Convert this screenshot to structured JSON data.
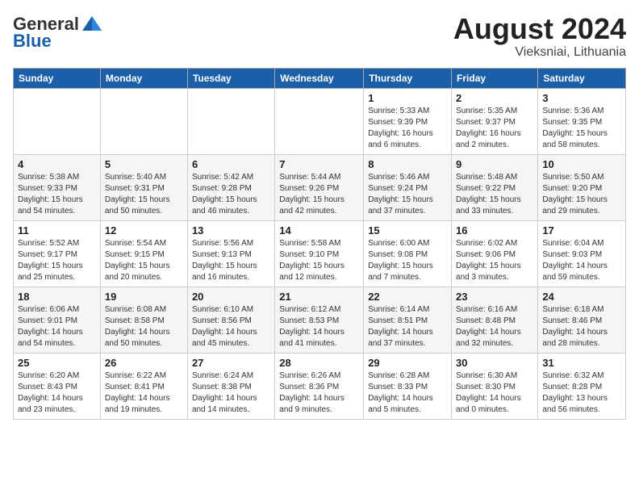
{
  "header": {
    "logo_general": "General",
    "logo_blue": "Blue",
    "month_title": "August 2024",
    "location": "Vieksniai, Lithuania"
  },
  "weekdays": [
    "Sunday",
    "Monday",
    "Tuesday",
    "Wednesday",
    "Thursday",
    "Friday",
    "Saturday"
  ],
  "weeks": [
    [
      {
        "day": "",
        "info": ""
      },
      {
        "day": "",
        "info": ""
      },
      {
        "day": "",
        "info": ""
      },
      {
        "day": "",
        "info": ""
      },
      {
        "day": "1",
        "info": "Sunrise: 5:33 AM\nSunset: 9:39 PM\nDaylight: 16 hours\nand 6 minutes."
      },
      {
        "day": "2",
        "info": "Sunrise: 5:35 AM\nSunset: 9:37 PM\nDaylight: 16 hours\nand 2 minutes."
      },
      {
        "day": "3",
        "info": "Sunrise: 5:36 AM\nSunset: 9:35 PM\nDaylight: 15 hours\nand 58 minutes."
      }
    ],
    [
      {
        "day": "4",
        "info": "Sunrise: 5:38 AM\nSunset: 9:33 PM\nDaylight: 15 hours\nand 54 minutes."
      },
      {
        "day": "5",
        "info": "Sunrise: 5:40 AM\nSunset: 9:31 PM\nDaylight: 15 hours\nand 50 minutes."
      },
      {
        "day": "6",
        "info": "Sunrise: 5:42 AM\nSunset: 9:28 PM\nDaylight: 15 hours\nand 46 minutes."
      },
      {
        "day": "7",
        "info": "Sunrise: 5:44 AM\nSunset: 9:26 PM\nDaylight: 15 hours\nand 42 minutes."
      },
      {
        "day": "8",
        "info": "Sunrise: 5:46 AM\nSunset: 9:24 PM\nDaylight: 15 hours\nand 37 minutes."
      },
      {
        "day": "9",
        "info": "Sunrise: 5:48 AM\nSunset: 9:22 PM\nDaylight: 15 hours\nand 33 minutes."
      },
      {
        "day": "10",
        "info": "Sunrise: 5:50 AM\nSunset: 9:20 PM\nDaylight: 15 hours\nand 29 minutes."
      }
    ],
    [
      {
        "day": "11",
        "info": "Sunrise: 5:52 AM\nSunset: 9:17 PM\nDaylight: 15 hours\nand 25 minutes."
      },
      {
        "day": "12",
        "info": "Sunrise: 5:54 AM\nSunset: 9:15 PM\nDaylight: 15 hours\nand 20 minutes."
      },
      {
        "day": "13",
        "info": "Sunrise: 5:56 AM\nSunset: 9:13 PM\nDaylight: 15 hours\nand 16 minutes."
      },
      {
        "day": "14",
        "info": "Sunrise: 5:58 AM\nSunset: 9:10 PM\nDaylight: 15 hours\nand 12 minutes."
      },
      {
        "day": "15",
        "info": "Sunrise: 6:00 AM\nSunset: 9:08 PM\nDaylight: 15 hours\nand 7 minutes."
      },
      {
        "day": "16",
        "info": "Sunrise: 6:02 AM\nSunset: 9:06 PM\nDaylight: 15 hours\nand 3 minutes."
      },
      {
        "day": "17",
        "info": "Sunrise: 6:04 AM\nSunset: 9:03 PM\nDaylight: 14 hours\nand 59 minutes."
      }
    ],
    [
      {
        "day": "18",
        "info": "Sunrise: 6:06 AM\nSunset: 9:01 PM\nDaylight: 14 hours\nand 54 minutes."
      },
      {
        "day": "19",
        "info": "Sunrise: 6:08 AM\nSunset: 8:58 PM\nDaylight: 14 hours\nand 50 minutes."
      },
      {
        "day": "20",
        "info": "Sunrise: 6:10 AM\nSunset: 8:56 PM\nDaylight: 14 hours\nand 45 minutes."
      },
      {
        "day": "21",
        "info": "Sunrise: 6:12 AM\nSunset: 8:53 PM\nDaylight: 14 hours\nand 41 minutes."
      },
      {
        "day": "22",
        "info": "Sunrise: 6:14 AM\nSunset: 8:51 PM\nDaylight: 14 hours\nand 37 minutes."
      },
      {
        "day": "23",
        "info": "Sunrise: 6:16 AM\nSunset: 8:48 PM\nDaylight: 14 hours\nand 32 minutes."
      },
      {
        "day": "24",
        "info": "Sunrise: 6:18 AM\nSunset: 8:46 PM\nDaylight: 14 hours\nand 28 minutes."
      }
    ],
    [
      {
        "day": "25",
        "info": "Sunrise: 6:20 AM\nSunset: 8:43 PM\nDaylight: 14 hours\nand 23 minutes."
      },
      {
        "day": "26",
        "info": "Sunrise: 6:22 AM\nSunset: 8:41 PM\nDaylight: 14 hours\nand 19 minutes."
      },
      {
        "day": "27",
        "info": "Sunrise: 6:24 AM\nSunset: 8:38 PM\nDaylight: 14 hours\nand 14 minutes."
      },
      {
        "day": "28",
        "info": "Sunrise: 6:26 AM\nSunset: 8:36 PM\nDaylight: 14 hours\nand 9 minutes."
      },
      {
        "day": "29",
        "info": "Sunrise: 6:28 AM\nSunset: 8:33 PM\nDaylight: 14 hours\nand 5 minutes."
      },
      {
        "day": "30",
        "info": "Sunrise: 6:30 AM\nSunset: 8:30 PM\nDaylight: 14 hours\nand 0 minutes."
      },
      {
        "day": "31",
        "info": "Sunrise: 6:32 AM\nSunset: 8:28 PM\nDaylight: 13 hours\nand 56 minutes."
      }
    ]
  ]
}
